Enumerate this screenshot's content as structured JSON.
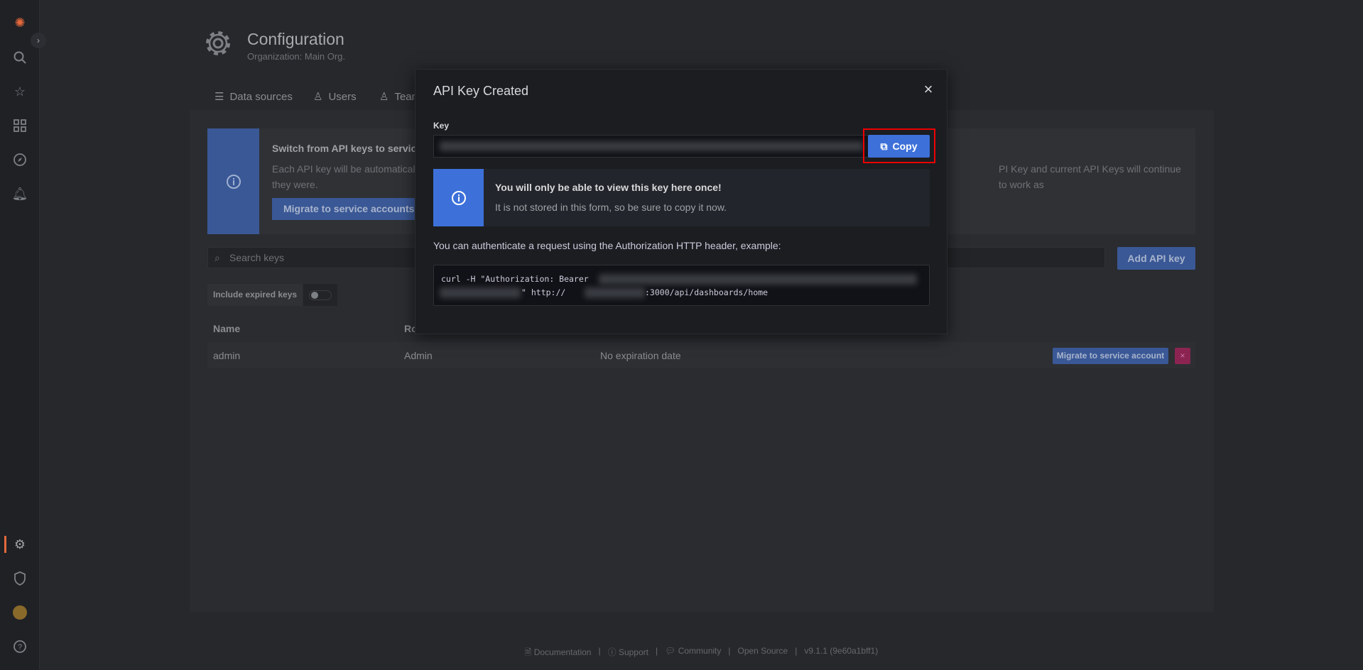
{
  "sidebar": {
    "items": [
      "grafana-logo",
      "search",
      "starred",
      "dashboards",
      "explore",
      "alerting",
      "configuration",
      "server-admin",
      "profile",
      "help"
    ]
  },
  "header": {
    "title": "Configuration",
    "subtitle": "Organization: Main Org."
  },
  "tabs": [
    {
      "label": "Data sources",
      "icon": "database-icon"
    },
    {
      "label": "Users",
      "icon": "user-icon"
    },
    {
      "label": "Team",
      "icon": "users-icon"
    }
  ],
  "alert": {
    "title": "Switch from API keys to service",
    "text_left": "Each API key will be automatical",
    "text_right": "PI Key and current API Keys will continue to work as",
    "text_line2": "they were.",
    "button": "Migrate to service accounts n"
  },
  "search": {
    "placeholder": "Search keys"
  },
  "add_key_label": "Add API key",
  "include_expired_label": "Include expired keys",
  "include_expired_enabled": false,
  "table": {
    "headers": [
      "Name",
      "Ro"
    ],
    "rows": [
      {
        "name": "admin",
        "role": "Admin",
        "expiry": "No expiration date",
        "migrate": "Migrate to service account",
        "delete": "×"
      }
    ]
  },
  "footer": {
    "items": [
      "Documentation",
      "Support",
      "Community",
      "Open Source",
      "v9.1.1 (9e60a1bff1)"
    ],
    "separator": "|"
  },
  "modal": {
    "title": "API Key Created",
    "close": "×",
    "key_label": "Key",
    "copy_label": "Copy",
    "warning_title": "You will only be able to view this key here once!",
    "warning_text": "It is not stored in this form, so be sure to copy it now.",
    "auth_text": "You can authenticate a request using the Authorization HTTP header, example:",
    "code_line1": "curl -H \"Authorization: Bearer",
    "code_line2_mid": "\" http://",
    "code_line2_end": ":3000/api/dashboards/home"
  },
  "colors": {
    "primary": "#3d71d9",
    "highlight": "#ee0000",
    "danger": "#8c2452",
    "accent": "#e3683c"
  }
}
